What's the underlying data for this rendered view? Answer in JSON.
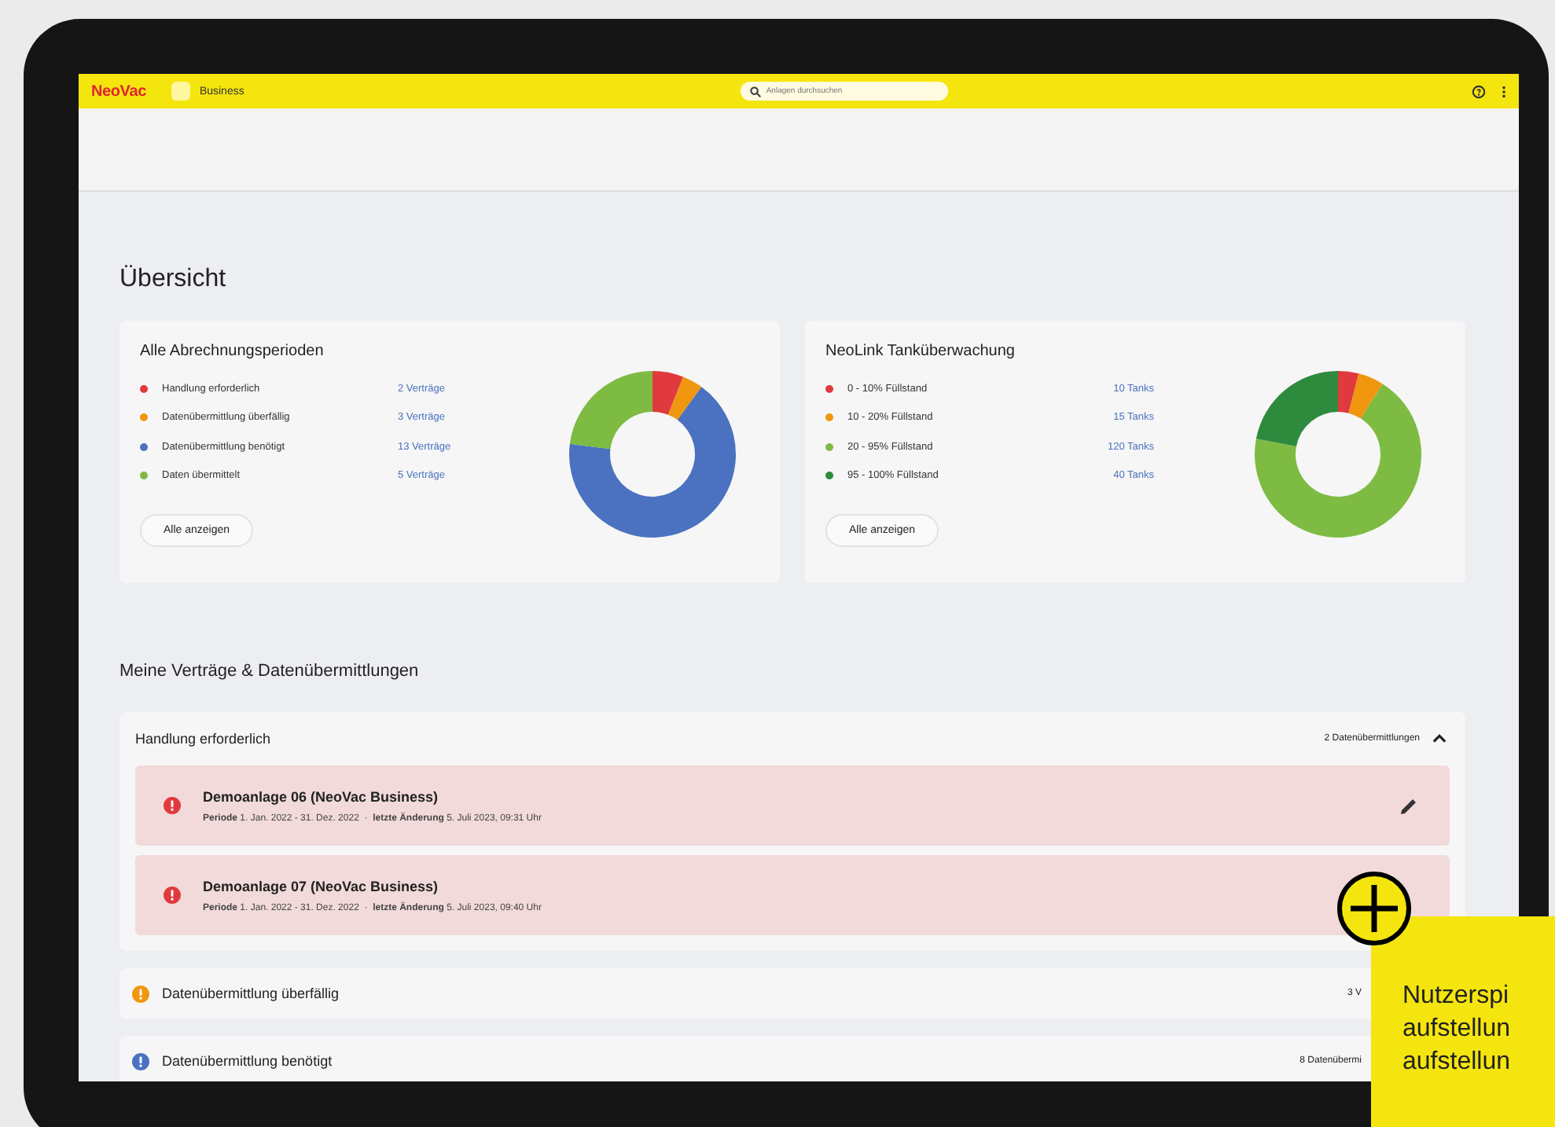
{
  "topbar": {
    "logo": "NeoVac",
    "app_label": "Business",
    "search": {
      "placeholder": "Anlagen durchsuchen"
    }
  },
  "page_title": "Übersicht",
  "cards": [
    {
      "title": "Alle Abrechnungsperioden",
      "legend": [
        {
          "label": "Handlung erforderlich",
          "value": "2 Verträge",
          "color": "#e03a3e"
        },
        {
          "label": "Datenübermittlung überfällig",
          "value": "3 Verträge",
          "color": "#f0960f"
        },
        {
          "label": "Datenübermittlung benötigt",
          "value": "13 Verträge",
          "color": "#4a72c0"
        },
        {
          "label": "Daten übermittelt",
          "value": "5 Verträge",
          "color": "#7dbb42"
        }
      ],
      "button": "Alle anzeigen",
      "chart_data": {
        "type": "donut",
        "values": [
          6,
          4,
          67,
          23
        ]
      }
    },
    {
      "title": "NeoLink Tanküberwachung",
      "legend": [
        {
          "label": "0 - 10% Füllstand",
          "value": "10 Tanks",
          "color": "#e03a3e"
        },
        {
          "label": "10 - 20% Füllstand",
          "value": "15 Tanks",
          "color": "#f0960f"
        },
        {
          "label": "20 - 95% Füllstand",
          "value": "120 Tanks",
          "color": "#7dbb42"
        },
        {
          "label": "95 - 100% Füllstand",
          "value": "40 Tanks",
          "color": "#2e8b3e"
        }
      ],
      "button": "Alle anzeigen",
      "chart_data": {
        "type": "donut",
        "values": [
          4,
          5,
          69,
          22
        ]
      }
    }
  ],
  "section_title": "Meine Verträge & Datenübermittlungen",
  "groups": [
    {
      "title": "Handlung erforderlich",
      "color": "#e03a3e",
      "count": "2 Datenübermittlungen",
      "expanded": true,
      "items": [
        {
          "title": "Demoanlage 06 (NeoVac Business)",
          "meta": "**Periode** 1. Jan. 2022 - 31. Dez. 2022  ·  **letzte Änderung** 5. Juli 2023, 09:31 Uhr",
          "editable": true
        },
        {
          "title": "Demoanlage 07 (NeoVac Business)",
          "meta": "**Periode** 1. Jan. 2022 - 31. Dez. 2022  ·  **letzte Änderung** 5. Juli 2023, 09:40 Uhr",
          "editable": false
        }
      ]
    },
    {
      "title": "Datenübermittlung überfällig",
      "color": "#f0960f",
      "count": "3 V",
      "expanded": false
    },
    {
      "title": "Datenübermittlung benötigt",
      "color": "#4a72c0",
      "count": "8 Datenübermi",
      "expanded": false
    }
  ],
  "promo": {
    "lines": [
      "Nutzerspi",
      "aufstellun",
      "aufstellun"
    ]
  }
}
